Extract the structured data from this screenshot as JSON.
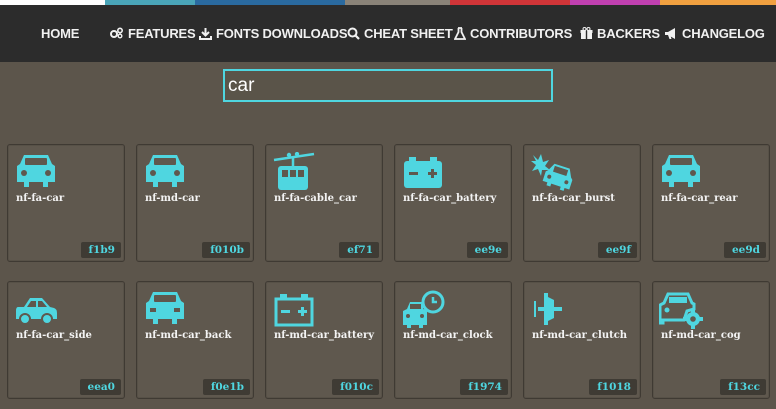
{
  "colors": {
    "accent": "#4fd6e0",
    "page_bg": "#5c554b",
    "nav_bg": "#2c2c2c",
    "stripes": [
      "#ffffff",
      "#4aa5b8",
      "#2a6aa0",
      "#8a8378",
      "#d03538",
      "#c040b0",
      "#f0a040"
    ]
  },
  "nav": [
    {
      "label": "HOME",
      "icon": "none"
    },
    {
      "label": "FEATURES",
      "icon": "gears-icon"
    },
    {
      "label": "FONTS DOWNLOADS",
      "icon": "download-icon"
    },
    {
      "label": "CHEAT SHEET",
      "icon": "search-icon"
    },
    {
      "label": "CONTRIBUTORS",
      "icon": "flask-icon"
    },
    {
      "label": "BACKERS",
      "icon": "gift-icon"
    },
    {
      "label": "CHANGELOG",
      "icon": "bullhorn-icon"
    }
  ],
  "search": {
    "value": "car",
    "placeholder": ""
  },
  "icons": [
    {
      "name": "nf-fa-car",
      "code": "f1b9",
      "glyph": "car"
    },
    {
      "name": "nf-md-car",
      "code": "f010b",
      "glyph": "car"
    },
    {
      "name": "nf-fa-cable_car",
      "code": "ef71",
      "glyph": "cable-car"
    },
    {
      "name": "nf-fa-car_battery",
      "code": "ee9e",
      "glyph": "battery-solid"
    },
    {
      "name": "nf-fa-car_burst",
      "code": "ee9f",
      "glyph": "car-burst"
    },
    {
      "name": "nf-fa-car_rear",
      "code": "ee9d",
      "glyph": "car"
    },
    {
      "name": "nf-fa-car_side",
      "code": "eea0",
      "glyph": "car-side"
    },
    {
      "name": "nf-md-car_back",
      "code": "f0e1b",
      "glyph": "car"
    },
    {
      "name": "nf-md-car_battery",
      "code": "f010c",
      "glyph": "battery-outline"
    },
    {
      "name": "nf-md-car_clock",
      "code": "f1974",
      "glyph": "car-clock"
    },
    {
      "name": "nf-md-car_clutch",
      "code": "f1018",
      "glyph": "clutch"
    },
    {
      "name": "nf-md-car_cog",
      "code": "f13cc",
      "glyph": "car-cog"
    }
  ]
}
